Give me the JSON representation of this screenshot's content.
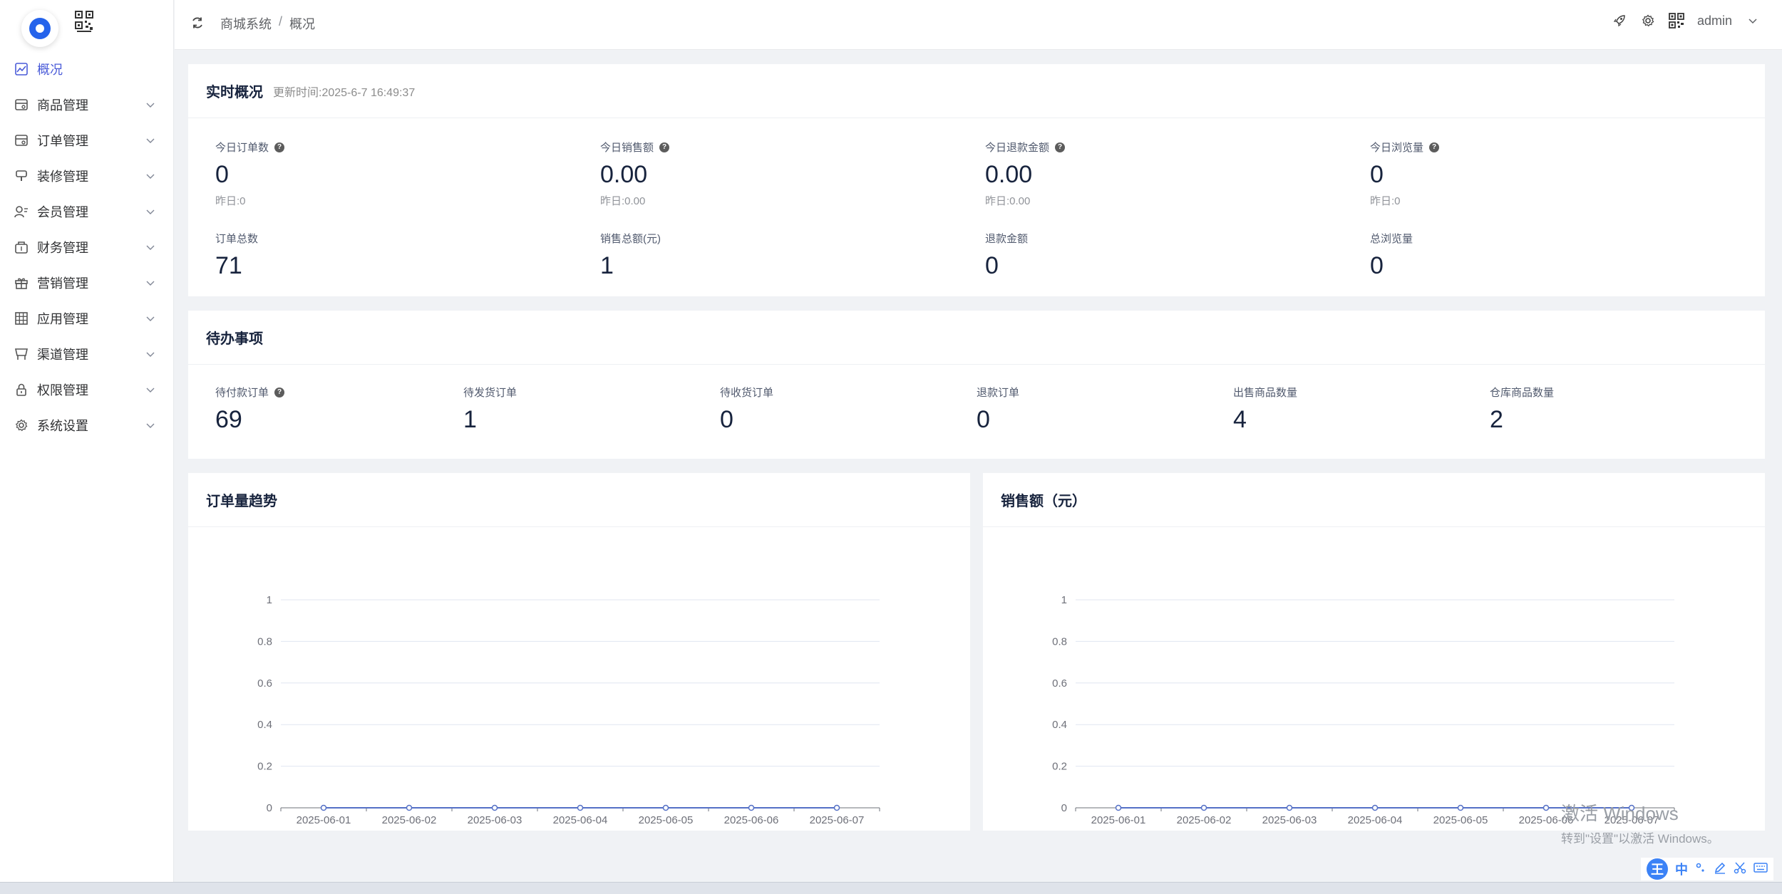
{
  "sidebar": {
    "items": [
      {
        "label": "概况",
        "icon": "chart-line-icon",
        "active": true
      },
      {
        "label": "商品管理",
        "icon": "goods-icon"
      },
      {
        "label": "订单管理",
        "icon": "order-icon"
      },
      {
        "label": "装修管理",
        "icon": "decoration-icon"
      },
      {
        "label": "会员管理",
        "icon": "member-icon"
      },
      {
        "label": "财务管理",
        "icon": "finance-icon"
      },
      {
        "label": "营销管理",
        "icon": "gift-icon"
      },
      {
        "label": "应用管理",
        "icon": "app-grid-icon"
      },
      {
        "label": "渠道管理",
        "icon": "channel-icon"
      },
      {
        "label": "权限管理",
        "icon": "lock-icon"
      },
      {
        "label": "系统设置",
        "icon": "gear-icon"
      }
    ]
  },
  "header": {
    "breadcrumb": [
      "商城系统",
      "概况"
    ],
    "separator": "/",
    "user": "admin"
  },
  "realtime": {
    "title": "实时概况",
    "updated": "更新时间:2025-6-7 16:49:37",
    "today": [
      {
        "label": "今日订单数",
        "value": "0",
        "yesterday": "昨日:0"
      },
      {
        "label": "今日销售额",
        "value": "0.00",
        "yesterday": "昨日:0.00"
      },
      {
        "label": "今日退款金额",
        "value": "0.00",
        "yesterday": "昨日:0.00"
      },
      {
        "label": "今日浏览量",
        "value": "0",
        "yesterday": "昨日:0"
      }
    ],
    "totals": [
      {
        "label": "订单总数",
        "value": "71"
      },
      {
        "label": "销售总额(元)",
        "value": "1"
      },
      {
        "label": "退款金额",
        "value": "0"
      },
      {
        "label": "总浏览量",
        "value": "0"
      }
    ]
  },
  "todo": {
    "title": "待办事项",
    "items": [
      {
        "label": "待付款订单",
        "value": "69",
        "help": true
      },
      {
        "label": "待发货订单",
        "value": "1"
      },
      {
        "label": "待收货订单",
        "value": "0"
      },
      {
        "label": "退款订单",
        "value": "0"
      },
      {
        "label": "出售商品数量",
        "value": "4"
      },
      {
        "label": "仓库商品数量",
        "value": "2"
      }
    ]
  },
  "chart_data": [
    {
      "type": "line",
      "title": "订单量趋势",
      "x": [
        "2025-06-01",
        "2025-06-02",
        "2025-06-03",
        "2025-06-04",
        "2025-06-05",
        "2025-06-06",
        "2025-06-07"
      ],
      "series": [
        {
          "values": [
            0,
            0,
            0,
            0,
            0,
            0,
            0
          ]
        }
      ],
      "yticks": [
        "0",
        "0.2",
        "0.4",
        "0.6",
        "0.8",
        "1"
      ],
      "ylim": [
        0,
        1
      ],
      "grid": true,
      "color": "#5470c6"
    },
    {
      "type": "line",
      "title": "销售额（元）",
      "x": [
        "2025-06-01",
        "2025-06-02",
        "2025-06-03",
        "2025-06-04",
        "2025-06-05",
        "2025-06-06",
        "2025-06-07"
      ],
      "series": [
        {
          "values": [
            0,
            0,
            0,
            0,
            0,
            0,
            0
          ]
        }
      ],
      "yticks": [
        "0",
        "0.2",
        "0.4",
        "0.6",
        "0.8",
        "1"
      ],
      "ylim": [
        0,
        1
      ],
      "grid": true,
      "color": "#5470c6"
    }
  ],
  "watermark": {
    "line1": "激活 Windows",
    "line2": "转到\"设置\"以激活 Windows。"
  },
  "ime": {
    "logo": "王",
    "mode": "中"
  }
}
